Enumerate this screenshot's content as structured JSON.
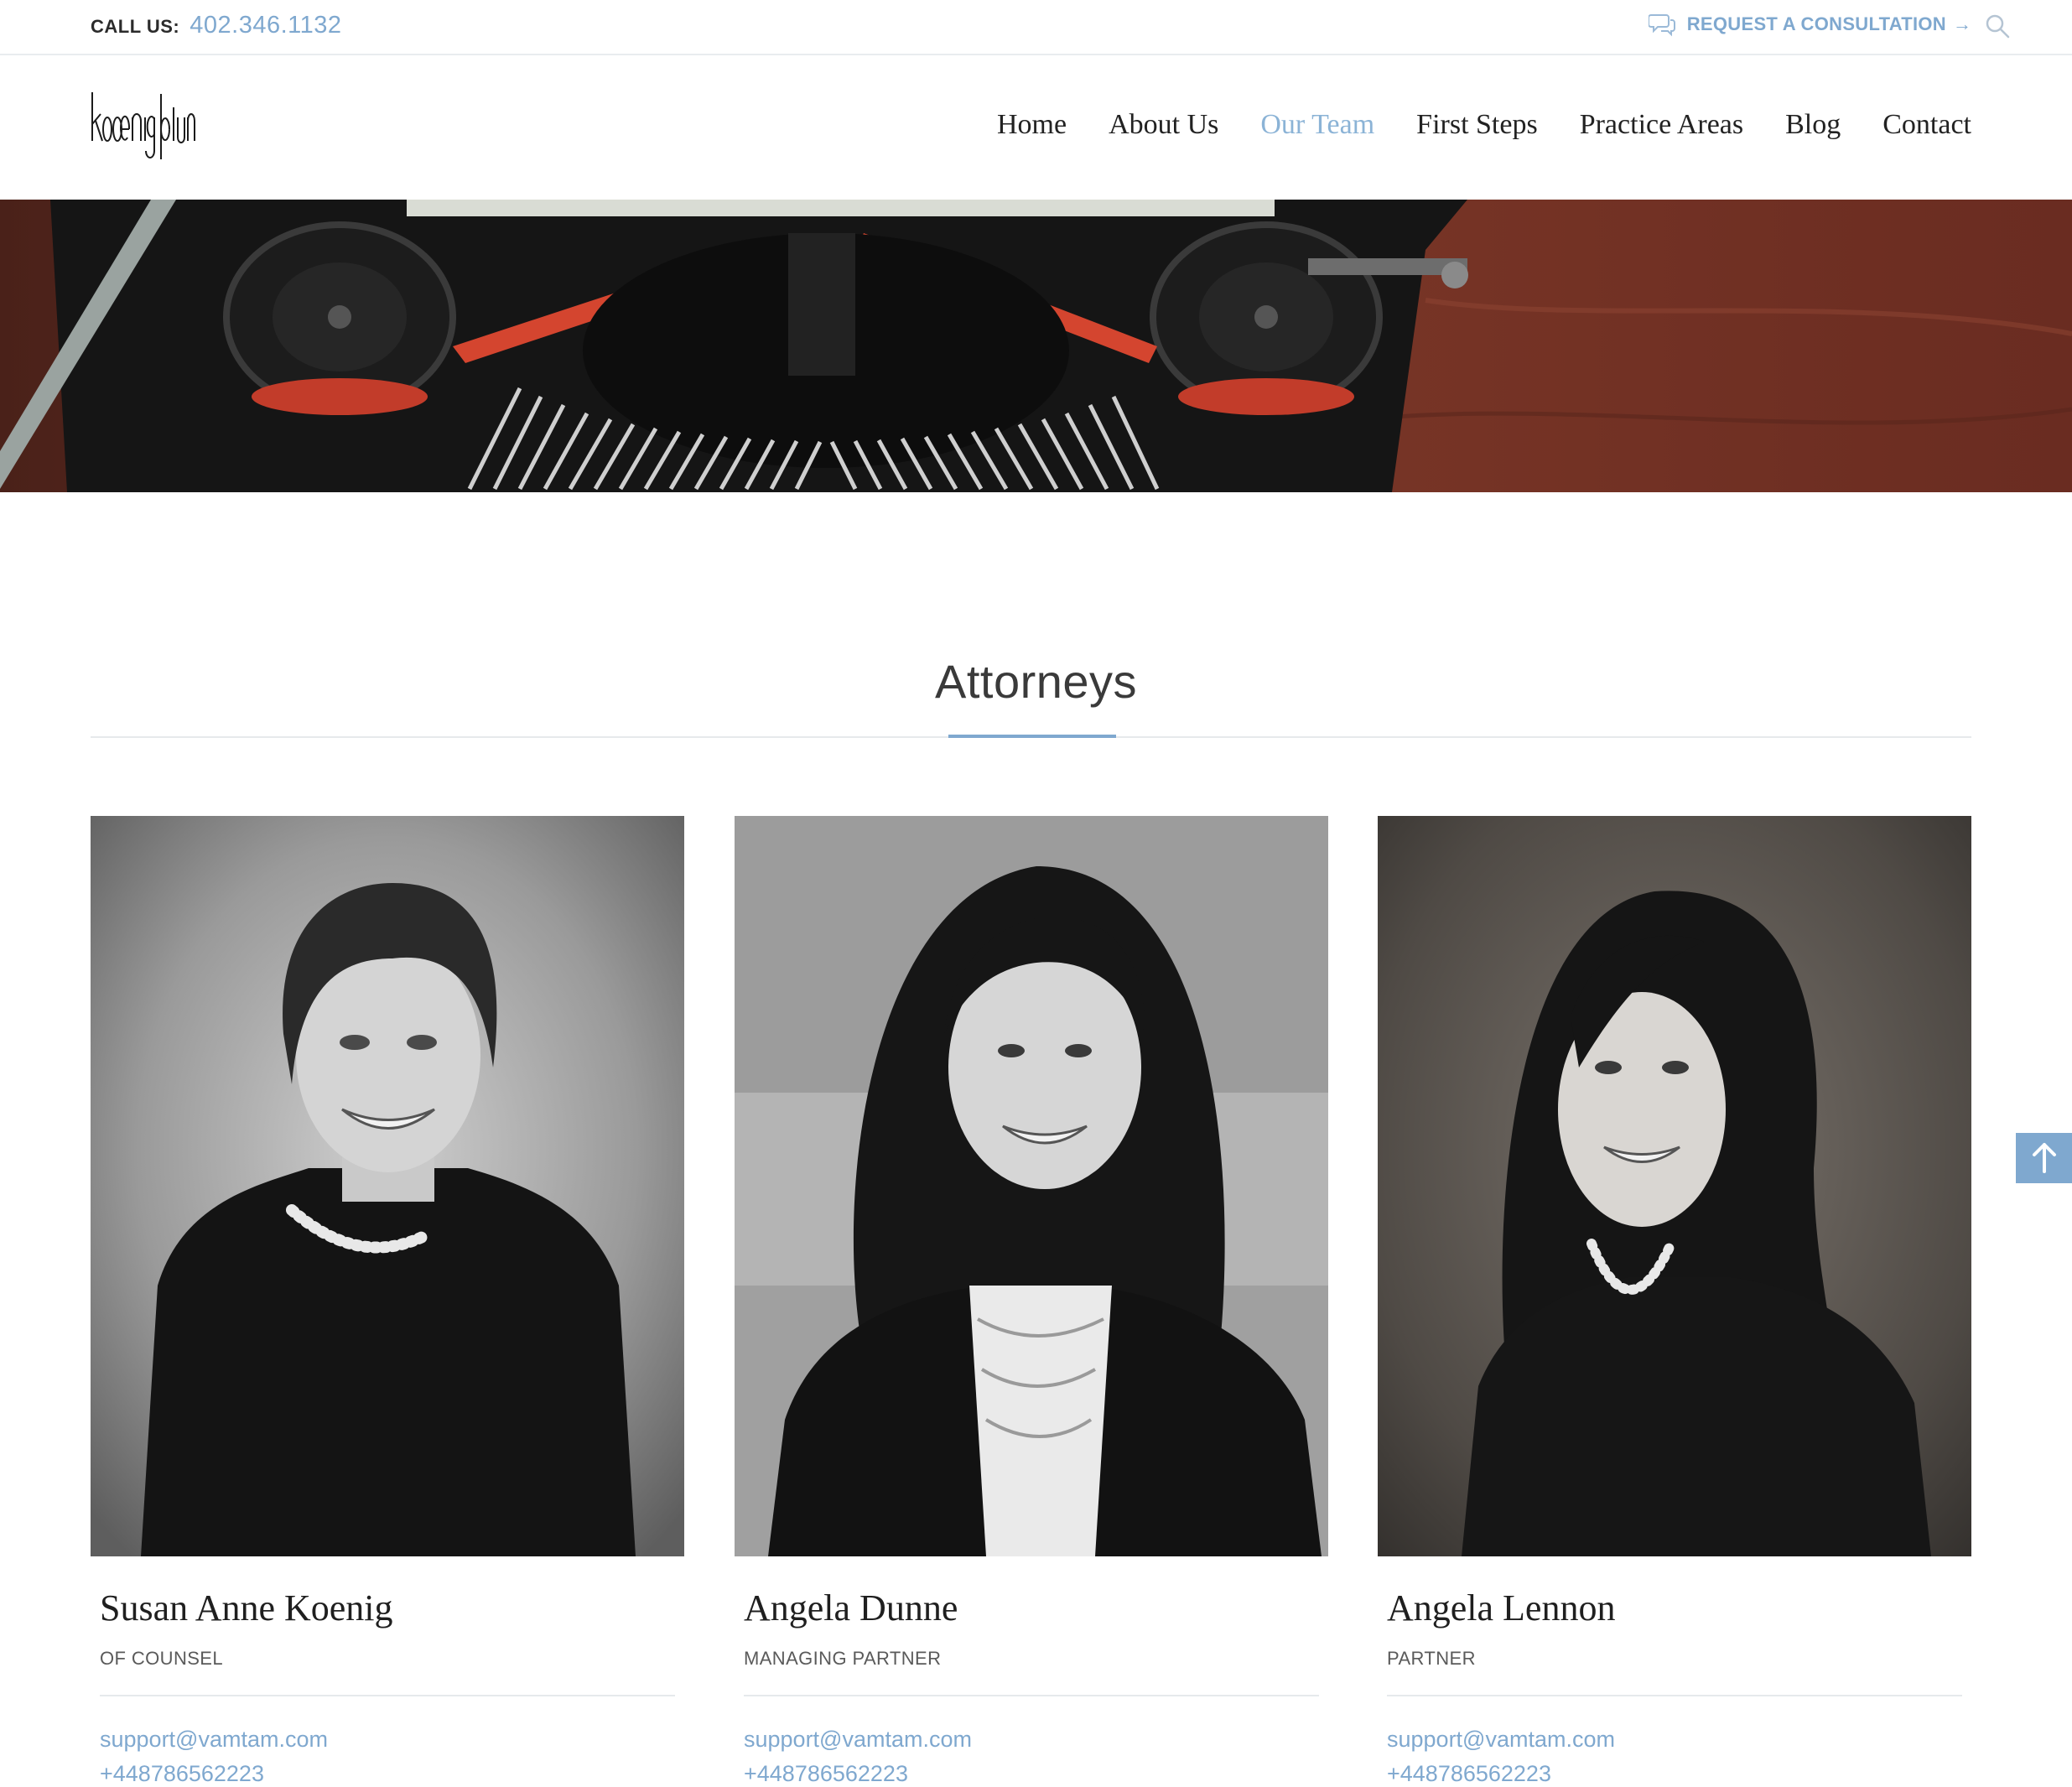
{
  "topbar": {
    "call_label": "CALL US:",
    "phone": "402.346.1132",
    "consult_label": "REQUEST A CONSULTATION",
    "consult_arrow": "→"
  },
  "nav": {
    "items": [
      {
        "label": "Home",
        "active": false
      },
      {
        "label": "About Us",
        "active": false
      },
      {
        "label": "Our Team",
        "active": true
      },
      {
        "label": "First Steps",
        "active": false
      },
      {
        "label": "Practice Areas",
        "active": false
      },
      {
        "label": "Blog",
        "active": false
      },
      {
        "label": "Contact",
        "active": false
      }
    ]
  },
  "colors": {
    "accent": "#7fa8cf",
    "nav_active": "#8bb3d6",
    "text": "#222222"
  },
  "section": {
    "title": "Attorneys"
  },
  "attorneys": [
    {
      "name": "Susan Anne Koenig",
      "role": "OF COUNSEL",
      "email": "support@vamtam.com",
      "phone": "+448786562223"
    },
    {
      "name": "Angela Dunne",
      "role": "MANAGING PARTNER",
      "email": "support@vamtam.com",
      "phone": "+448786562223"
    },
    {
      "name": "Angela Lennon",
      "role": "PARTNER",
      "email": "support@vamtam.com",
      "phone": "+448786562223"
    }
  ],
  "icons": {
    "consult": "chat-bubbles-icon",
    "search": "search-icon",
    "to_top": "arrow-up-icon"
  }
}
